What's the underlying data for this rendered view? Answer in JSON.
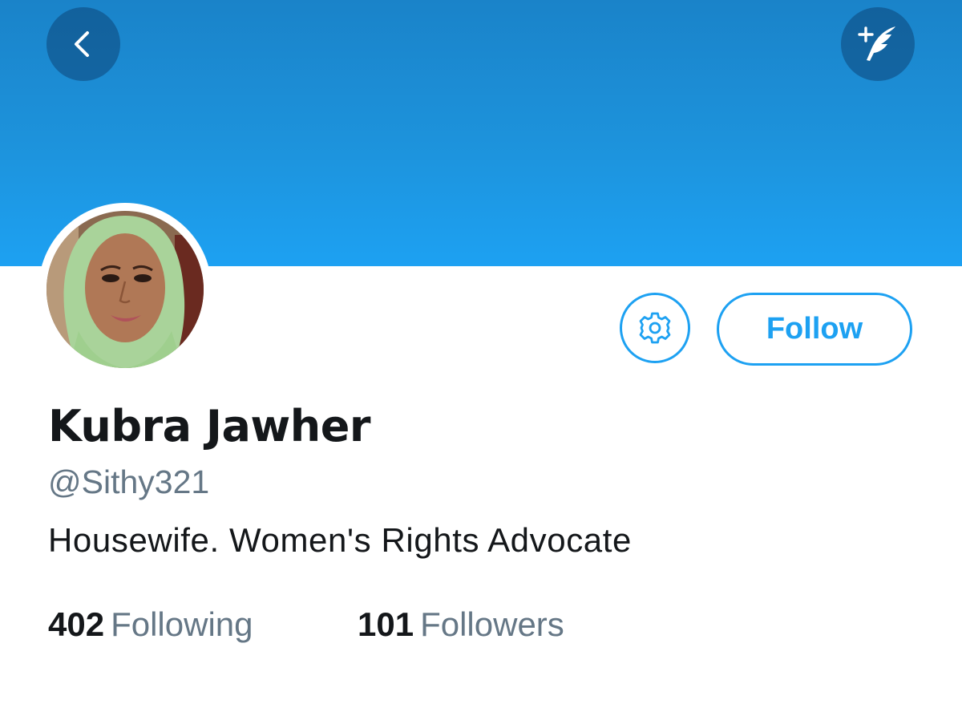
{
  "header": {
    "back_icon": "chevron-left-icon",
    "compose_icon": "compose-quill-icon",
    "banner_color": "#1da1f2"
  },
  "profile": {
    "display_name": "Kubra Jawher",
    "handle": "@Sithy321",
    "bio": "Housewife. Women's Rights Advocate",
    "settings_icon": "gear-icon",
    "follow_label": "Follow",
    "accent_color": "#1da1f2"
  },
  "stats": {
    "following_count": "402",
    "following_label": "Following",
    "followers_count": "101",
    "followers_label": "Followers"
  }
}
